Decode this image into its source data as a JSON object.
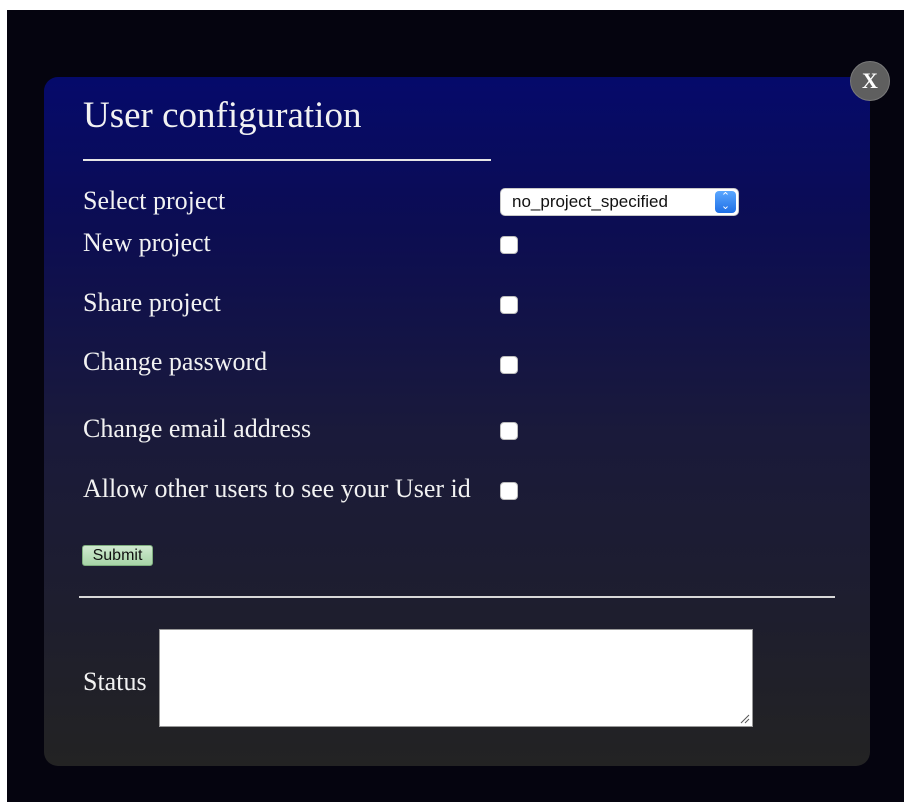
{
  "dialog": {
    "title": "User configuration",
    "close_label": "X"
  },
  "form": {
    "select_project_label": "Select project",
    "select_project_value": "no_project_specified",
    "options": [
      {
        "label": "New project",
        "checked": false
      },
      {
        "label": "Share project",
        "checked": false
      },
      {
        "label": "Change password",
        "checked": false
      },
      {
        "label": "Change email address",
        "checked": false
      },
      {
        "label": "Allow other users to see your User id",
        "checked": false
      }
    ],
    "submit_label": "Submit",
    "status_label": "Status",
    "status_value": ""
  },
  "colors": {
    "backdrop": "#05040f",
    "dialog_top": "#050a6b",
    "dialog_bottom": "#232323",
    "submit_bg": "#a7d4a7",
    "select_accent": "#1f6fe6"
  },
  "icons": {
    "close": "close-icon",
    "select_arrows": "chevron-up-down-icon",
    "resize": "resize-grip-icon"
  }
}
